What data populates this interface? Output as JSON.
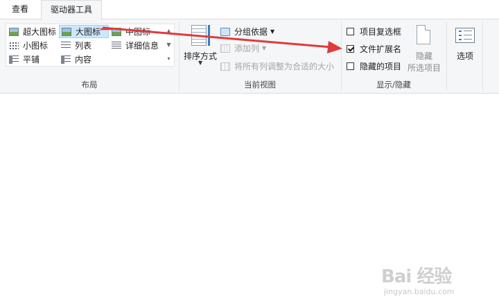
{
  "tabs": [
    {
      "label": "查看"
    },
    {
      "label": "驱动器工具"
    }
  ],
  "layout_group": {
    "label": "布局",
    "items": [
      {
        "label": "超大图标",
        "icon": "extra-large-icons-icon"
      },
      {
        "label": "大图标",
        "icon": "large-icons-icon",
        "selected": true
      },
      {
        "label": "中图标",
        "icon": "medium-icons-icon"
      },
      {
        "label": "小图标",
        "icon": "small-icons-icon"
      },
      {
        "label": "列表",
        "icon": "list-icon"
      },
      {
        "label": "详细信息",
        "icon": "details-icon"
      },
      {
        "label": "平铺",
        "icon": "tiles-icon"
      },
      {
        "label": "内容",
        "icon": "content-icon"
      }
    ]
  },
  "current_view_group": {
    "label": "当前视图",
    "sort_label": "排序方式",
    "group_by": "分组依据",
    "add_columns": "添加列",
    "fit_columns": "将所有列调整为合适的大小"
  },
  "show_hide_group": {
    "label": "显示/隐藏",
    "checkboxes": [
      {
        "label": "项目复选框",
        "checked": false
      },
      {
        "label": "文件扩展名",
        "checked": true
      },
      {
        "label": "隐藏的项目",
        "checked": false
      }
    ],
    "hide_selected_line1": "隐藏",
    "hide_selected_line2": "所选项目"
  },
  "options": {
    "label": "选项"
  },
  "annotation": {
    "color": "#e03a3a"
  },
  "watermark": {
    "brand": "Bai 经验",
    "url": "jingyan.baidu.com"
  }
}
